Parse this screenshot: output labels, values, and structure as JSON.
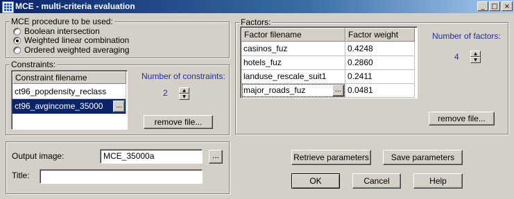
{
  "window": {
    "title": "MCE - multi-criteria evaluation"
  },
  "procedure": {
    "label": "MCE procedure to be used:",
    "options": [
      "Boolean intersection",
      "Weighted linear combination",
      "Ordered weighted averaging"
    ],
    "selected": "Weighted linear combination"
  },
  "constraints": {
    "label": "Constraints:",
    "column_header": "Constraint filename",
    "rows": [
      "ct96_popdensity_reclass",
      "ct96_avgincome_35000"
    ],
    "number_label": "Number of constraints:",
    "count": "2",
    "remove_label": "remove file..."
  },
  "factors": {
    "label": "Factors:",
    "columns": [
      "Factor filename",
      "Factor weight"
    ],
    "rows": [
      {
        "file": "casinos_fuz",
        "weight": "0.4248"
      },
      {
        "file": "hotels_fuz",
        "weight": "0.2860"
      },
      {
        "file": "landuse_rescale_suit1",
        "weight": "0.2411"
      },
      {
        "file": "major_roads_fuz",
        "weight": "0.0481"
      }
    ],
    "number_label": "Number of factors:",
    "count": "4",
    "remove_label": "remove file..."
  },
  "output": {
    "image_label": "Output image:",
    "image_value": "MCE_35000a",
    "title_label": "Title:",
    "title_value": ""
  },
  "buttons": {
    "retrieve": "Retrieve parameters",
    "save": "Save parameters",
    "ok": "OK",
    "cancel": "Cancel",
    "help": "Help"
  }
}
